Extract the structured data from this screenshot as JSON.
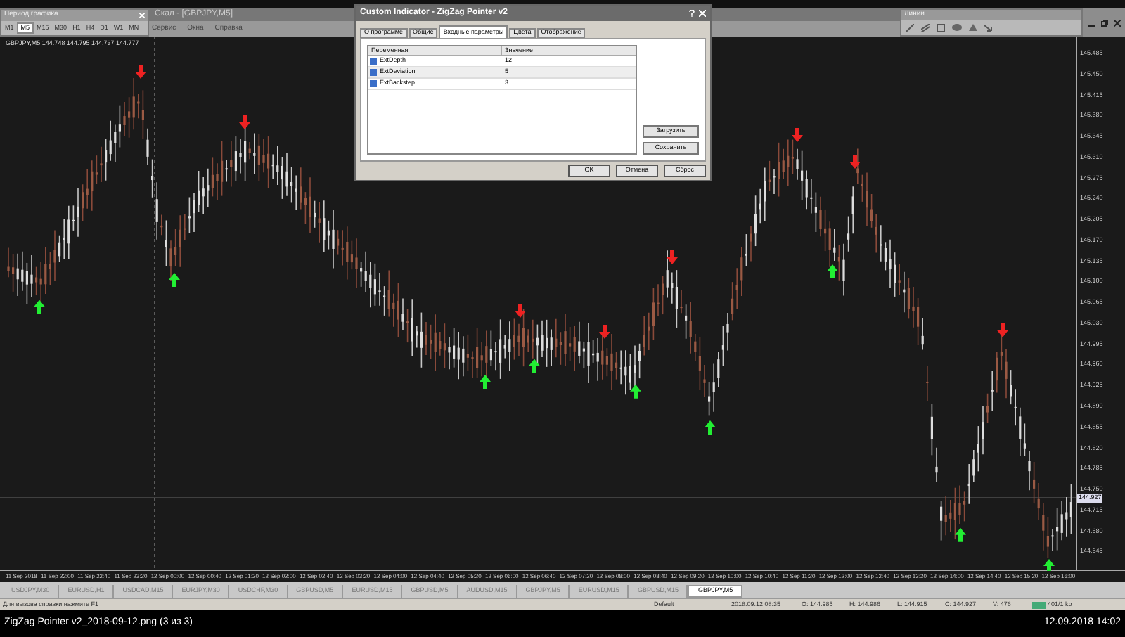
{
  "window": {
    "title": "Скал - [GBPJPY,M5]"
  },
  "timeframe_panel": {
    "title": "Период графика",
    "items": [
      {
        "label": "M1",
        "selected": false
      },
      {
        "label": "M5",
        "selected": true
      },
      {
        "label": "M15",
        "selected": false
      },
      {
        "label": "M30",
        "selected": false
      },
      {
        "label": "H1",
        "selected": false
      },
      {
        "label": "H4",
        "selected": false
      },
      {
        "label": "D1",
        "selected": false
      },
      {
        "label": "W1",
        "selected": false
      },
      {
        "label": "MN",
        "selected": false
      }
    ]
  },
  "menu": [
    "Сервис",
    "Окна",
    "Справка"
  ],
  "lines_panel": {
    "title": "Линии"
  },
  "chart": {
    "header": "GBPJPY,M5  144.748 144.795 144.737 144.777",
    "current_price": "144.927",
    "price_axis": [
      "145.485",
      "145.450",
      "145.415",
      "145.380",
      "145.345",
      "145.310",
      "145.275",
      "145.240",
      "145.205",
      "145.170",
      "145.135",
      "145.100",
      "145.065",
      "145.030",
      "144.995",
      "144.960",
      "144.925",
      "144.890",
      "144.855",
      "144.820",
      "144.785",
      "144.750",
      "144.715",
      "144.680",
      "144.645"
    ],
    "time_axis": [
      "11 Sep 2018",
      "11 Sep 22:00",
      "11 Sep 22:40",
      "11 Sep 23:20",
      "12 Sep 00:00",
      "12 Sep 00:40",
      "12 Sep 01:20",
      "12 Sep 02:00",
      "12 Sep 02:40",
      "12 Sep 03:20",
      "12 Sep 04:00",
      "12 Sep 04:40",
      "12 Sep 05:20",
      "12 Sep 06:00",
      "12 Sep 06:40",
      "12 Sep 07:20",
      "12 Sep 08:00",
      "12 Sep 08:40",
      "12 Sep 09:20",
      "12 Sep 10:00",
      "12 Sep 10:40",
      "12 Sep 11:20",
      "12 Sep 12:00",
      "12 Sep 12:40",
      "12 Sep 13:20",
      "12 Sep 14:00",
      "12 Sep 14:40",
      "12 Sep 15:20",
      "12 Sep 16:00"
    ]
  },
  "dialog": {
    "title": "Custom Indicator - ZigZag Pointer v2",
    "tabs": [
      {
        "label": "О программе",
        "selected": false
      },
      {
        "label": "Общие",
        "selected": false
      },
      {
        "label": "Входные параметры",
        "selected": true
      },
      {
        "label": "Цвета",
        "selected": false
      },
      {
        "label": "Отображение",
        "selected": false
      }
    ],
    "columns": [
      "Переменная",
      "Значение"
    ],
    "rows": [
      {
        "name": "ExtDepth",
        "value": "12"
      },
      {
        "name": "ExtDeviation",
        "value": "5"
      },
      {
        "name": "ExtBackstep",
        "value": "3"
      }
    ],
    "side_buttons": [
      "Загрузить",
      "Сохранить"
    ],
    "buttons": [
      "OK",
      "Отмена",
      "Сброс"
    ]
  },
  "chart_tabs": [
    {
      "label": "USDJPY,M30",
      "selected": false
    },
    {
      "label": "EURUSD,H1",
      "selected": false
    },
    {
      "label": "USDCAD,M15",
      "selected": false
    },
    {
      "label": "EURJPY,M30",
      "selected": false
    },
    {
      "label": "USDCHF,M30",
      "selected": false
    },
    {
      "label": "GBPUSD,M5",
      "selected": false
    },
    {
      "label": "EURUSD,M15",
      "selected": false
    },
    {
      "label": "GBPUSD,M5",
      "selected": false
    },
    {
      "label": "AUDUSD,M15",
      "selected": false
    },
    {
      "label": "GBPJPY,M5",
      "selected": false
    },
    {
      "label": "EURUSD,M15",
      "selected": false
    },
    {
      "label": "GBPUSD,M15",
      "selected": false
    },
    {
      "label": "GBPJPY,M5",
      "selected": true
    }
  ],
  "status_bar": {
    "help": "Для вызова справки нажмите F1",
    "profile": "Default",
    "time": "2018.09.12 08:35",
    "open": "O: 144.985",
    "high": "H: 144.986",
    "low": "L: 144.915",
    "close": "C: 144.927",
    "volume": "V: 476",
    "traffic": "401/1 kb"
  },
  "viewer": {
    "filename": "ZigZag Pointer v2_2018-09-12.png (3 из 3)",
    "datetime": "12.09.2018 14:02"
  }
}
